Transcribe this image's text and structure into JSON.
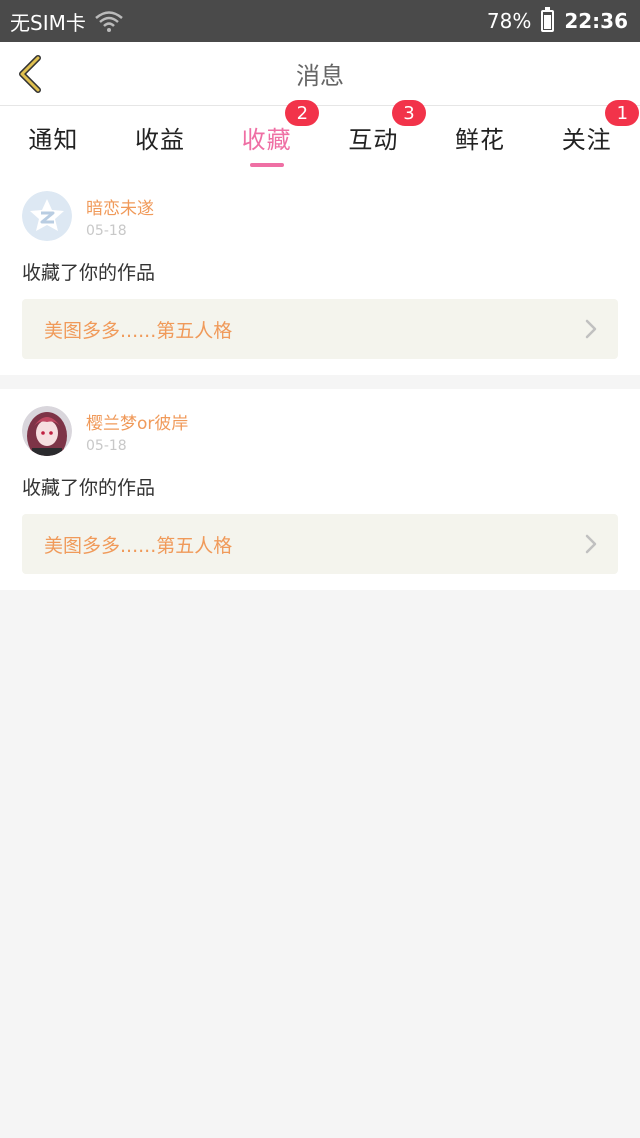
{
  "status_bar": {
    "carrier": "无SIM卡",
    "battery": "78%",
    "time": "22:36"
  },
  "header": {
    "title": "消息"
  },
  "tabs": [
    {
      "label": "通知",
      "badge": ""
    },
    {
      "label": "收益",
      "badge": ""
    },
    {
      "label": "收藏",
      "badge": "2",
      "active": true
    },
    {
      "label": "互动",
      "badge": "3"
    },
    {
      "label": "鲜花",
      "badge": ""
    },
    {
      "label": "关注",
      "badge": "1"
    }
  ],
  "items": [
    {
      "username": "暗恋未遂",
      "date": "05-18",
      "action": "收藏了你的作品",
      "work_title": "美图多多......第五人格"
    },
    {
      "username": "樱兰梦or彼岸",
      "date": "05-18",
      "action": "收藏了你的作品",
      "work_title": "美图多多......第五人格"
    }
  ],
  "colors": {
    "accent": "#ef6fa4",
    "badge": "#f2334a",
    "username": "#f09a5a",
    "back_arrow": "#e0c050"
  }
}
